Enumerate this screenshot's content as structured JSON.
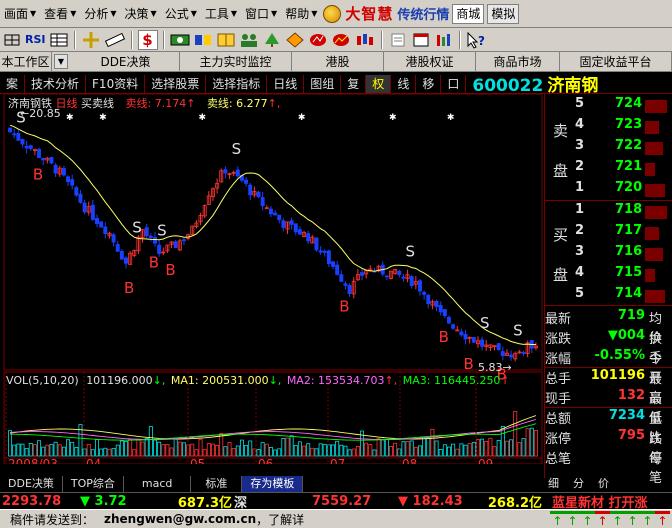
{
  "menu": {
    "items": [
      "画面",
      "查看",
      "分析",
      "决策",
      "公式",
      "工具",
      "窗口",
      "帮助"
    ],
    "brand_name": "大智慧",
    "brand_sub": "传统行情",
    "tabs": [
      "商城",
      "模拟"
    ]
  },
  "toolbar": {
    "rsi_label": "RSI",
    "dollar_label": "$"
  },
  "nav": {
    "items": [
      "本工作区",
      "DDE决策",
      "主力实时监控",
      "港股",
      "港股权证",
      "商品市场",
      "固定收益平台"
    ],
    "dropdown_icon": "chevron-down-icon"
  },
  "chartbar": {
    "items": [
      "案",
      "技术分析",
      "F10资料",
      "选择股票",
      "选择指标",
      "日线",
      "图组",
      "复",
      "权",
      "线",
      "移",
      "口"
    ],
    "active_item": "权",
    "stock_code": "600022",
    "stock_name": "济南钢"
  },
  "legend": {
    "stock_name": "济南钢铁",
    "period": "日线",
    "indicator": "买卖线",
    "buy_label": "卖线:",
    "buy_value": "7.174",
    "sell_label": "卖线:",
    "sell_value": "6.277",
    "high_label": "20.85",
    "low_label": "5.83"
  },
  "volume_legend": {
    "vol": "VOL(5,10,20)",
    "vol_value": "101196.000",
    "ma1": "MA1: 200531.000",
    "ma2": "MA2: 153534.703",
    "ma3": "MA3: 116445.250"
  },
  "dates": [
    "2008/03",
    "04",
    "05",
    "06",
    "07",
    "08",
    "09"
  ],
  "orderbook": {
    "sell_label": "卖盘",
    "buy_label": "买盘",
    "sell": [
      {
        "idx": "5",
        "price": "724"
      },
      {
        "idx": "4",
        "price": "723"
      },
      {
        "idx": "3",
        "price": "722"
      },
      {
        "idx": "2",
        "price": "721"
      },
      {
        "idx": "1",
        "price": "720"
      }
    ],
    "buy": [
      {
        "idx": "1",
        "price": "718"
      },
      {
        "idx": "2",
        "price": "717"
      },
      {
        "idx": "3",
        "price": "716"
      },
      {
        "idx": "4",
        "price": "715"
      },
      {
        "idx": "5",
        "price": "714"
      }
    ]
  },
  "quote": [
    {
      "label": "最新",
      "value": "719",
      "label2": "均价",
      "color": "#00ff00"
    },
    {
      "label": "涨跌",
      "value": "▼004",
      "label2": "换手",
      "color": "#00ff00"
    },
    {
      "label": "涨幅",
      "value": "-0.55%",
      "label2": "今开",
      "color": "#00ff00"
    },
    {
      "label": "总手",
      "value": "101196",
      "label2": "最高",
      "color": "#ffff00"
    },
    {
      "label": "现手",
      "value": "132",
      "label2": "最低",
      "color": "#ff3333"
    },
    {
      "label": "总额",
      "value": "7234",
      "label2": "量比",
      "color": "#00e0e0"
    },
    {
      "label": "涨停",
      "value": "795",
      "label2": "跌停",
      "color": "#ff3333"
    },
    {
      "label": "总笔",
      "value": "",
      "label2": "每笔",
      "color": "#e0e0e0"
    }
  ],
  "bottom_tabs": [
    "TOP综合",
    "macd",
    "标准",
    "存为模板"
  ],
  "bottom_active": "存为模板",
  "bottom_first": "DDE决策",
  "quote_tabs": [
    "细",
    "分",
    "价"
  ],
  "index_bar": {
    "v1": "2293.78",
    "v2": "▼ 3.72",
    "v3": "687.3亿",
    "v3b": "深",
    "v4": "7559.27",
    "v5": "▼ 182.43",
    "v6": "268.2亿",
    "news": "蓝星新材 打开涨"
  },
  "status": {
    "left": "稿件请发送到：",
    "email": "zhengwen@gw.com.cn",
    "right": "，了解详"
  },
  "colors": {
    "up": "#ff3333",
    "down": "#00ff00",
    "candle_down": "#1a40ff",
    "ma": "#ffff66",
    "frame": "#7a0000"
  }
}
